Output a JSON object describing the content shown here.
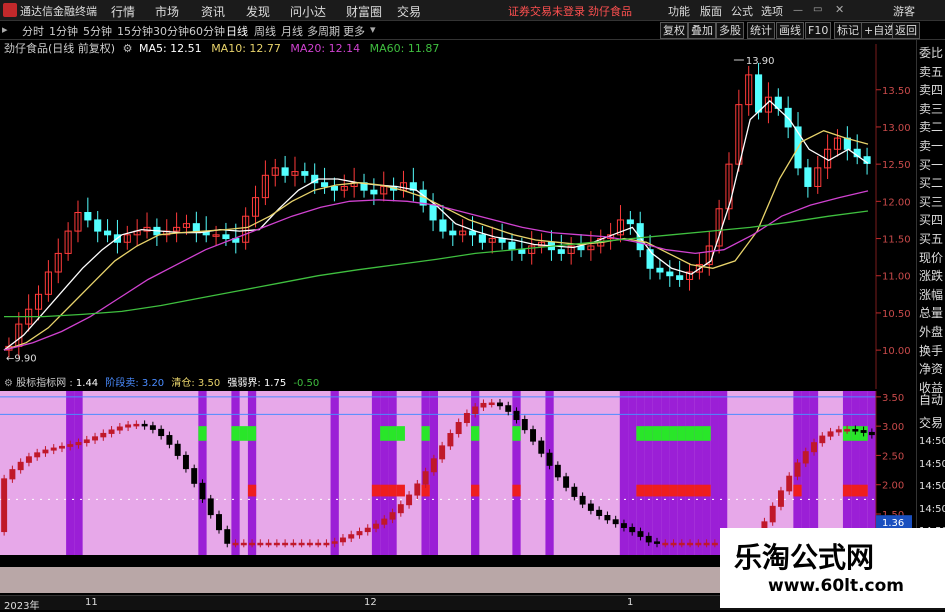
{
  "titlebar": {
    "app_name": "通达信金融终端",
    "menus": [
      "行情",
      "市场",
      "资讯",
      "发现",
      "问小达",
      "财富圈",
      "交易"
    ],
    "red_links": [
      "证券交易未登录",
      "劲仔食品"
    ],
    "right_menus": [
      "功能",
      "版面",
      "公式",
      "选项",
      "游客"
    ]
  },
  "periodbar": {
    "periods": [
      "分时",
      "1分钟",
      "5分钟",
      "15分钟",
      "30分钟",
      "60分钟",
      "日线",
      "周线",
      "月线",
      "多周期",
      "更多"
    ],
    "active": "日线",
    "tools": [
      "复权",
      "叠加",
      "多股",
      "统计",
      "画线",
      "F10",
      "标记",
      "+自选",
      "返回"
    ]
  },
  "main_info": {
    "title": "劲仔食品(日线 前复权)",
    "ma5": "MA5: 12.51",
    "ma10": "MA10: 12.77",
    "ma20": "MA20: 12.14",
    "ma60": "MA60: 11.87"
  },
  "sub_info": {
    "title": "股标指标网",
    "v1": "1.44",
    "v2": "阶段卖: 3.20",
    "v3": "清仓: 3.50",
    "v4": "强弱界: 1.75",
    "v5": "-0.50"
  },
  "side_panel": [
    "委比",
    "卖五",
    "卖四",
    "卖三",
    "卖二",
    "卖一",
    "买一",
    "买二",
    "买三",
    "买四",
    "买五",
    "现价",
    "涨跌",
    "涨幅",
    "总量",
    "外盘",
    "换手",
    "净资",
    "收益",
    "自动",
    "交易",
    "14:50",
    "14:50",
    "14:50",
    "14:50",
    "14:50",
    "14:50",
    "14:50"
  ],
  "statusbar": {
    "labels": [
      "2023年",
      "11",
      "12",
      "1"
    ]
  },
  "watermark": {
    "title": "乐淘公式网",
    "url": "www.60lt.com"
  },
  "chart_data": [
    {
      "type": "candlestick",
      "title": "劲仔食品(日线 前复权)",
      "ylim": [
        9.8,
        13.9
      ],
      "y_ticks": [
        "13.50",
        "13.00",
        "12.50",
        "12.00",
        "11.50",
        "11.00",
        "10.50",
        "10.00"
      ],
      "annotations": [
        {
          "label": "13.90",
          "kind": "high"
        },
        {
          "label": "9.90",
          "kind": "low"
        }
      ],
      "series": [
        {
          "name": "MA5",
          "color": "#ffffff",
          "last": 12.51
        },
        {
          "name": "MA10",
          "color": "#e8d36b",
          "last": 12.77
        },
        {
          "name": "MA20",
          "color": "#d042d0",
          "last": 12.14
        },
        {
          "name": "MA60",
          "color": "#3fbf3f",
          "last": 11.87
        }
      ],
      "close": [
        10.05,
        10.35,
        10.55,
        10.75,
        11.05,
        11.3,
        11.6,
        11.85,
        11.75,
        11.6,
        11.55,
        11.45,
        11.55,
        11.6,
        11.65,
        11.55,
        11.6,
        11.65,
        11.7,
        11.6,
        11.55,
        11.55,
        11.5,
        11.45,
        11.8,
        12.05,
        12.35,
        12.45,
        12.35,
        12.4,
        12.35,
        12.25,
        12.2,
        12.15,
        12.2,
        12.25,
        12.15,
        12.1,
        12.2,
        12.15,
        12.25,
        12.15,
        11.95,
        11.75,
        11.6,
        11.55,
        11.6,
        11.55,
        11.45,
        11.5,
        11.45,
        11.35,
        11.3,
        11.4,
        11.45,
        11.35,
        11.3,
        11.4,
        11.35,
        11.4,
        11.5,
        11.55,
        11.75,
        11.7,
        11.35,
        11.1,
        11.05,
        11.0,
        10.95,
        11.05,
        11.15,
        11.4,
        11.9,
        12.5,
        13.3,
        13.7,
        13.2,
        13.4,
        13.25,
        13.0,
        12.45,
        12.2,
        12.45,
        12.7,
        12.85,
        12.7,
        12.6,
        12.51
      ],
      "ma_points": {
        "MA5": [
          10.0,
          10.2,
          10.5,
          10.8,
          11.1,
          11.35,
          11.55,
          11.62,
          11.6,
          11.58,
          11.58,
          11.62,
          11.6,
          11.62,
          11.9,
          12.15,
          12.3,
          12.3,
          12.25,
          12.22,
          12.2,
          12.15,
          11.95,
          11.7,
          11.6,
          11.52,
          11.48,
          11.42,
          11.4,
          11.38,
          11.45,
          11.55,
          11.65,
          11.3,
          11.1,
          11.02,
          11.2,
          12.0,
          13.1,
          13.35,
          13.1,
          12.7,
          12.55,
          12.7,
          12.51
        ],
        "MA10": [
          10.0,
          10.1,
          10.3,
          10.6,
          10.9,
          11.2,
          11.4,
          11.55,
          11.58,
          11.6,
          11.62,
          11.65,
          11.8,
          12.0,
          12.15,
          12.22,
          12.25,
          12.22,
          12.15,
          12.05,
          11.9,
          11.75,
          11.65,
          11.55,
          11.48,
          11.45,
          11.42,
          11.45,
          11.5,
          11.45,
          11.3,
          11.15,
          11.1,
          11.2,
          11.6,
          12.3,
          12.8,
          12.95,
          12.85,
          12.77
        ],
        "MA20": [
          10.0,
          10.1,
          10.25,
          10.45,
          10.7,
          10.95,
          11.15,
          11.35,
          11.5,
          11.65,
          11.8,
          11.92,
          12.0,
          12.02,
          12.0,
          11.95,
          11.85,
          11.75,
          11.65,
          11.58,
          11.55,
          11.52,
          11.45,
          11.35,
          11.3,
          11.35,
          11.55,
          11.8,
          11.95,
          12.05,
          12.14
        ],
        "MA60": [
          10.45,
          10.45,
          10.48,
          10.52,
          10.6,
          10.7,
          10.8,
          10.9,
          11.0,
          11.08,
          11.15,
          11.22,
          11.3,
          11.35,
          11.4,
          11.45,
          11.5,
          11.55,
          11.6,
          11.65,
          11.72,
          11.8,
          11.87
        ]
      }
    },
    {
      "type": "area",
      "title": "股标指标网",
      "ylim": [
        0.8,
        3.6
      ],
      "y_ticks": [
        "3.50",
        "3.00",
        "2.50",
        "2.00",
        "1.50",
        "1.00"
      ],
      "value_badge": "1.36",
      "reference_lines": [
        {
          "name": "清仓",
          "value": 3.5,
          "color": "#4a8cff"
        },
        {
          "name": "阶段卖",
          "value": 3.2,
          "color": "#4a8cff"
        },
        {
          "name": "强弱界",
          "value": 1.75,
          "color": "#ffffff"
        }
      ],
      "bands": [
        {
          "name": "purple",
          "color": "#9b1fd6",
          "columns": [
            8,
            9,
            24,
            28,
            30,
            40,
            45,
            46,
            47,
            51,
            52,
            57,
            62,
            66,
            75,
            76,
            77,
            78,
            79,
            80,
            81,
            82,
            83,
            84,
            85,
            86,
            87,
            96,
            97,
            98,
            102,
            103,
            104,
            105
          ]
        },
        {
          "name": "green",
          "color": "#29e629",
          "columns": [
            24,
            28,
            29,
            30,
            46,
            47,
            48,
            51,
            57,
            62,
            77,
            78,
            79,
            80,
            81,
            82,
            83,
            84,
            85,
            102,
            103,
            104
          ]
        },
        {
          "name": "red",
          "color": "#ee1e1e",
          "columns": [
            30,
            45,
            46,
            47,
            48,
            51,
            57,
            62,
            77,
            78,
            79,
            80,
            81,
            82,
            83,
            84,
            85,
            96,
            102,
            103,
            104
          ]
        }
      ]
    }
  ]
}
